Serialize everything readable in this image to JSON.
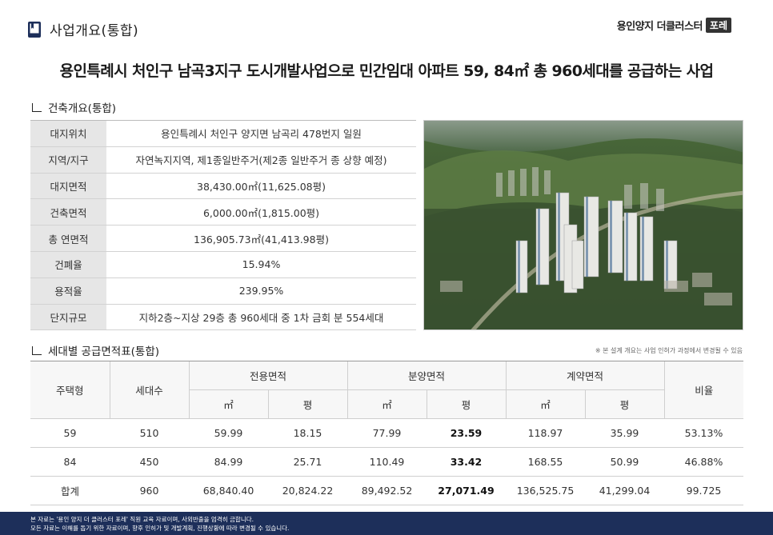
{
  "header": {
    "title": "사업개요(통합)"
  },
  "brand": {
    "name": "용인양지 더클러스터",
    "badge": "포레"
  },
  "headline": "용인특례시 처인구 남곡3지구 도시개발사업으로 민간임대 아파트 59, 84㎡ 총 960세대를 공급하는 사업",
  "build_section": {
    "title": "건축개요(통합)",
    "rows": [
      {
        "label": "대지위치",
        "value": "용인특례시 처인구 양지면 남곡리 478번지 일원"
      },
      {
        "label": "지역/지구",
        "value": "자연녹지지역, 제1종일반주거(제2종 일반주거 종 상향 예정)"
      },
      {
        "label": "대지면적",
        "value": "38,430.00㎡(11,625.08평)"
      },
      {
        "label": "건축면적",
        "value": "6,000.00㎡(1,815.00평)"
      },
      {
        "label": "총 연면적",
        "value": "136,905.73㎡(41,413.98평)"
      },
      {
        "label": "건폐율",
        "value": "15.94%"
      },
      {
        "label": "용적율",
        "value": "239.95%"
      },
      {
        "label": "단지규모",
        "value": "지하2층~지상 29층 총 960세대 중 1차 금회 분 554세대"
      }
    ]
  },
  "area_section": {
    "title": "세대별 공급면적표(통합)",
    "note": "※ 본 설계 개요는 사업 인허가 과정에서 변경될 수 있음",
    "headers": {
      "type": "주택형",
      "units": "세대수",
      "exclusive": "전용면적",
      "sale": "분양면적",
      "contract": "계약면적",
      "ratio": "비율",
      "sqm": "㎡",
      "pyeong": "평"
    },
    "rows": [
      {
        "type": "59",
        "units": "510",
        "ex_m2": "59.99",
        "ex_py": "18.15",
        "sale_m2": "77.99",
        "sale_py": "23.59",
        "ct_m2": "118.97",
        "ct_py": "35.99",
        "ratio": "53.13%"
      },
      {
        "type": "84",
        "units": "450",
        "ex_m2": "84.99",
        "ex_py": "25.71",
        "sale_m2": "110.49",
        "sale_py": "33.42",
        "ct_m2": "168.55",
        "ct_py": "50.99",
        "ratio": "46.88%"
      },
      {
        "type": "합계",
        "units": "960",
        "ex_m2": "68,840.40",
        "ex_py": "20,824.22",
        "sale_m2": "89,492.52",
        "sale_py": "27,071.49",
        "ct_m2": "136,525.75",
        "ct_py": "41,299.04",
        "ratio": "99.725"
      }
    ]
  },
  "footer": {
    "line1": "본 자료는 '용인 양지 더 클러스터 포레' 직원 교육 자료이며, 사외반출을 엄격히 금합니다.",
    "line2": "모든 자료는 이해를 돕기 위한 자료이며, 향후 인허가 및 개발계획, 진행상황에 따라 변경될 수 있습니다."
  }
}
